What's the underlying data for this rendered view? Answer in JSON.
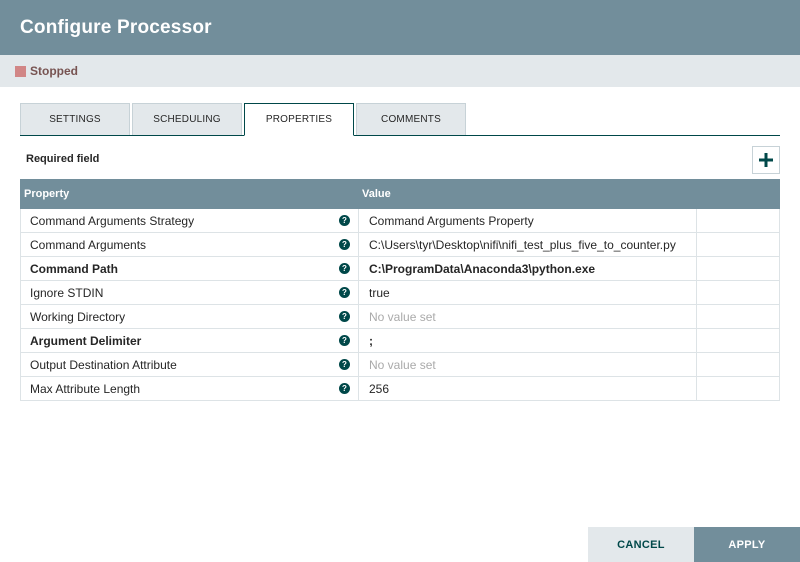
{
  "header": {
    "title": "Configure Processor"
  },
  "status": {
    "label": "Stopped",
    "color": "#d18686"
  },
  "tabs": [
    {
      "label": "SETTINGS",
      "active": false
    },
    {
      "label": "SCHEDULING",
      "active": false
    },
    {
      "label": "PROPERTIES",
      "active": true
    },
    {
      "label": "COMMENTS",
      "active": false
    }
  ],
  "properties_panel": {
    "required_label": "Required field",
    "add_icon": "plus-icon",
    "columns": {
      "property": "Property",
      "value": "Value"
    },
    "rows": [
      {
        "name": "Command Arguments Strategy",
        "value": "Command Arguments Property",
        "required": false,
        "empty": false
      },
      {
        "name": "Command Arguments",
        "value": "C:\\Users\\tyr\\Desktop\\nifi\\nifi_test_plus_five_to_counter.py",
        "required": false,
        "empty": false
      },
      {
        "name": "Command Path",
        "value": "C:\\ProgramData\\Anaconda3\\python.exe",
        "required": true,
        "empty": false
      },
      {
        "name": "Ignore STDIN",
        "value": "true",
        "required": false,
        "empty": false
      },
      {
        "name": "Working Directory",
        "value": "No value set",
        "required": false,
        "empty": true
      },
      {
        "name": "Argument Delimiter",
        "value": ";",
        "required": true,
        "empty": false
      },
      {
        "name": "Output Destination Attribute",
        "value": "No value set",
        "required": false,
        "empty": true
      },
      {
        "name": "Max Attribute Length",
        "value": "256",
        "required": false,
        "empty": false
      }
    ]
  },
  "footer": {
    "cancel_label": "CANCEL",
    "apply_label": "APPLY"
  },
  "colors": {
    "header": "#728e9b",
    "accent": "#004849",
    "status_bar": "#e3e8eb"
  }
}
